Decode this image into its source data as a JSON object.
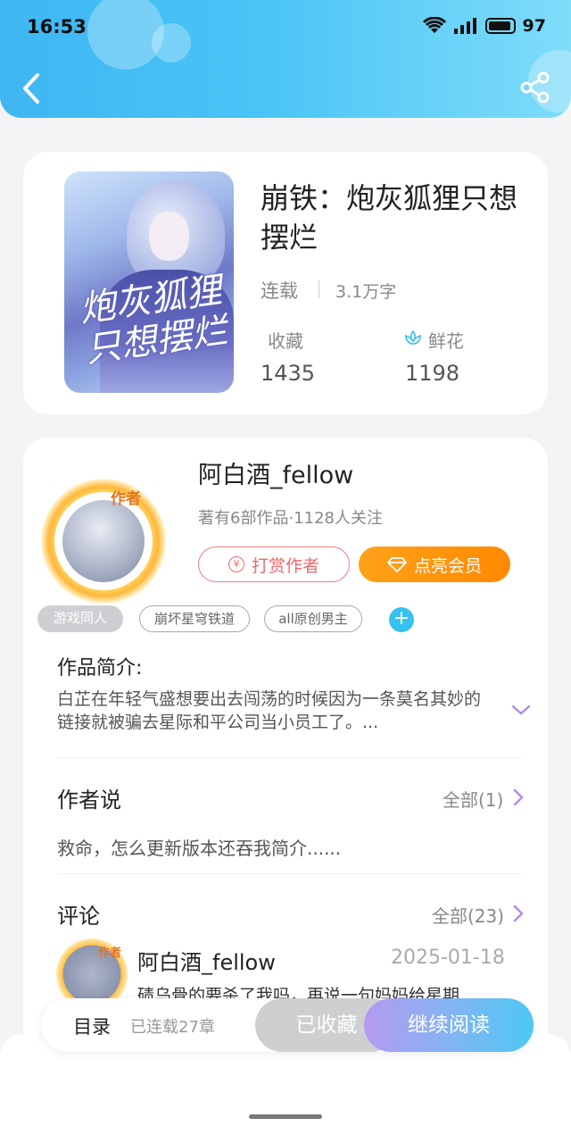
{
  "status_bar": {
    "time": "16:53",
    "battery": "97"
  },
  "book": {
    "title": "崩铁：炮灰狐狸只想摆烂",
    "cover_text": "炮灰狐狸只想摆烂",
    "status": "连载",
    "word_count": "3.1万字",
    "favorites_label": "收藏",
    "favorites_count": "1435",
    "flowers_label": "鲜花",
    "flowers_count": "1198"
  },
  "author": {
    "badge": "作者",
    "name": "阿白酒_fellow",
    "meta": "著有6部作品·1128人关注",
    "tip_label": "打赏作者",
    "vip_label": "点亮会员"
  },
  "tags": [
    "游戏同人",
    "崩坏星穹铁道",
    "all原创男主"
  ],
  "intro": {
    "title": "作品简介:",
    "text": "白芷在年轻气盛想要出去闯荡的时候因为一条莫名其妙的链接就被骗去星际和平公司当小员工了。..."
  },
  "author_says": {
    "title": "作者说",
    "all_label": "全部(1)",
    "text": "救命，怎么更新版本还吞我简介......"
  },
  "comments": {
    "title": "评论",
    "all_label": "全部(23)",
    "first": {
      "badge": "作者",
      "name": "阿白酒_fellow",
      "date": "2025-01-18",
      "text": "碛乌骨的要杀了我吗，再说一句妈妈给星期"
    }
  },
  "bottom_bar": {
    "toc_label": "目录",
    "chapters": "已连载27章",
    "favorited_label": "已收藏",
    "continue_label": "继续阅读"
  },
  "colors": {
    "header": "#49c4f6",
    "accent": "#35c2f1",
    "vip": "#ff9a10",
    "tip": "#f06a6a"
  }
}
